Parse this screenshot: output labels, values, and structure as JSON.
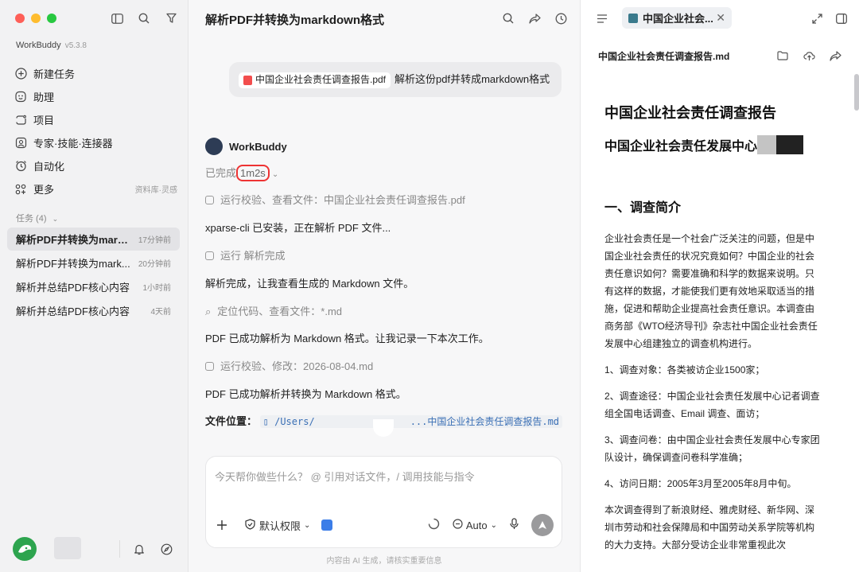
{
  "sidebar": {
    "brand": "WorkBuddy",
    "version": "v5.3.8",
    "nav": [
      {
        "label": "新建任务",
        "icon": "plus-circle-icon"
      },
      {
        "label": "助理",
        "icon": "assistant-icon"
      },
      {
        "label": "项目",
        "icon": "project-icon"
      },
      {
        "label": "专家·技能·连接器",
        "icon": "expert-icon"
      },
      {
        "label": "自动化",
        "icon": "alarm-icon"
      },
      {
        "label": "更多",
        "icon": "grid-icon",
        "extra": "资料库·灵感"
      }
    ],
    "tasks_header": "任务 (4)",
    "tasks": [
      {
        "label": "解析PDF并转换为mark...",
        "time": "17分钟前"
      },
      {
        "label": "解析PDF并转换为mark...",
        "time": "20分钟前"
      },
      {
        "label": "解析并总结PDF核心内容",
        "time": "1小时前"
      },
      {
        "label": "解析并总结PDF核心内容",
        "time": "4天前"
      }
    ]
  },
  "chat": {
    "title": "解析PDF并转换为markdown格式",
    "user_message": {
      "file": "中国企业社会责任调查报告.pdf",
      "text": "解析这份pdf并转成markdown格式"
    },
    "agent_name": "WorkBuddy",
    "status_prefix": "已完成",
    "duration": "1m2s",
    "steps": {
      "s1": "运行校验、查看文件：中国企业社会责任调查报告.pdf",
      "m1": "xparse-cli 已安装，正在解析 PDF 文件...",
      "s2": "运行 解析完成",
      "m2": "解析完成，让我查看生成的 Markdown 文件。",
      "s3": "定位代码、查看文件：*.md",
      "m3": "PDF 已成功解析为 Markdown 格式。让我记录一下本次工作。",
      "s4": "运行校验、修改：2026-08-04.md",
      "m4": "PDF 已成功解析并转换为 Markdown 格式。"
    },
    "path_label": "文件位置：",
    "path_start": "/Users/",
    "path_end": "...中国企业社会责任调查报告.md",
    "composer_placeholder": "今天帮你做些什么？ @ 引用对话文件，/ 调用技能与指令",
    "permission_label": "默认权限",
    "model_label": "Auto",
    "footnote": "内容由 AI 生成，请核实重要信息"
  },
  "doc": {
    "tab_label": "中国企业社会...",
    "file_name": "中国企业社会责任调查报告.md",
    "h1": "中国企业社会责任调查报告",
    "h1b": "中国企业社会责任发展中心",
    "h2": "一、调查简介",
    "p1": "企业社会责任是一个社会广泛关注的问题，但是中国企业社会责任的状况究竟如何？中国企业的社会责任意识如何？需要准确和科学的数据来说明。只有这样的数据，才能使我们更有效地采取适当的措施，促进和帮助企业提高社会责任意识。本调查由商务部《WTO经济导刊》杂志社中国企业社会责任发展中心组建独立的调查机构进行。",
    "p2": "1、调查对象：各类被访企业1500家；",
    "p3": "2、调查途径：中国企业社会责任发展中心记者调查组全国电话调查、Email 调查、面访；",
    "p4": "3、调查问卷：由中国企业社会责任发展中心专家团队设计，确保调查问卷科学准确；",
    "p5": "4、访问日期：2005年3月至2005年8月中旬。",
    "p6": "本次调查得到了新浪财经、雅虎财经、新华网、深圳市劳动和社会保障局和中国劳动关系学院等机构的大力支持。大部分受访企业非常重视此次"
  }
}
